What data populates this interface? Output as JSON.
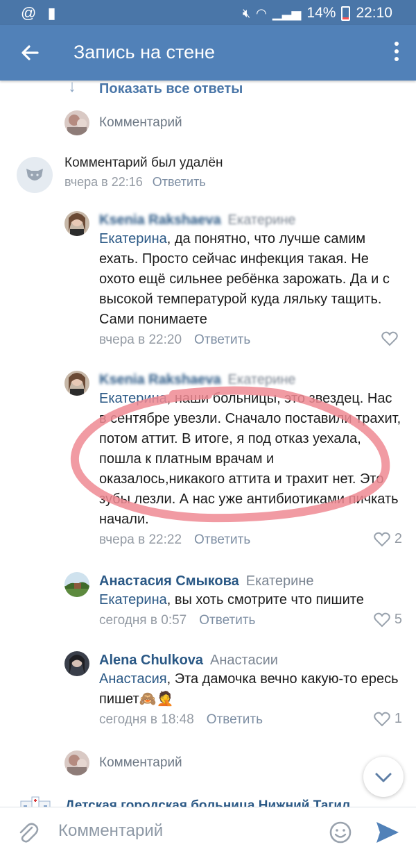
{
  "status_bar": {
    "icons_left": [
      "at-icon",
      "sim-alert-icon"
    ],
    "icons_right": [
      "mute-icon",
      "wifi-icon",
      "signal-icon"
    ],
    "battery": "14%",
    "time": "22:10"
  },
  "app_bar": {
    "title": "Запись на стене"
  },
  "show_all": {
    "label": "Показать все ответы"
  },
  "compose_top": {
    "placeholder": "Комментарий"
  },
  "deleted": {
    "text": "Комментарий был удалён",
    "time": "вчера в 22:16",
    "reply": "Ответить"
  },
  "comments": [
    {
      "author": "Ksenia Rakshaeva",
      "to": "Екатерине",
      "mention": "Екатерина",
      "text": ", да понятно, что лучше самим ехать. Просто сейчас инфекция такая. Не охото ещё сильнее ребёнка зарожать. Да и с высокой температурой куда ляльку тащить. Сами понимаете",
      "time": "вчера в 22:20",
      "reply": "Ответить",
      "likes": ""
    },
    {
      "author": "Ksenia Rakshaeva",
      "to": "Екатерине",
      "mention": "Екатерина",
      "text": ", наши больницы, это звездец. Нас в сентябре увезли. Сначало поставили трахит, потом аттит. В итоге, я под отказ уехала, пошла к платным врачам и оказалось,никакого аттита и трахит нет. Это зубы лезли. А нас уже антибиотиками пичкать начали.",
      "time": "вчера в 22:22",
      "reply": "Ответить",
      "likes": "2"
    },
    {
      "author": "Анастасия Смыкова",
      "to": "Екатерине",
      "mention": "Екатерина",
      "text": ", вы хоть смотрите что пишите",
      "time": "сегодня в 0:57",
      "reply": "Ответить",
      "likes": "5"
    },
    {
      "author": "Alena Chulkova",
      "to": "Анастасии",
      "mention": "Анастасия",
      "text": ", Эта дамочка вечно какую-то ересь пишет🙈🤦",
      "time": "сегодня в 18:48",
      "reply": "Ответить",
      "likes": "1"
    }
  ],
  "compose_bottom": {
    "placeholder": "Комментарий"
  },
  "group_preview": {
    "name": "Детская городская больница Нижний Тагил"
  },
  "bottom_bar": {
    "placeholder": "Комментарий"
  },
  "colors": {
    "accent": "#5181b8",
    "link": "#2a5885",
    "like": "#939aa3",
    "annotation": "#ee8a93"
  }
}
